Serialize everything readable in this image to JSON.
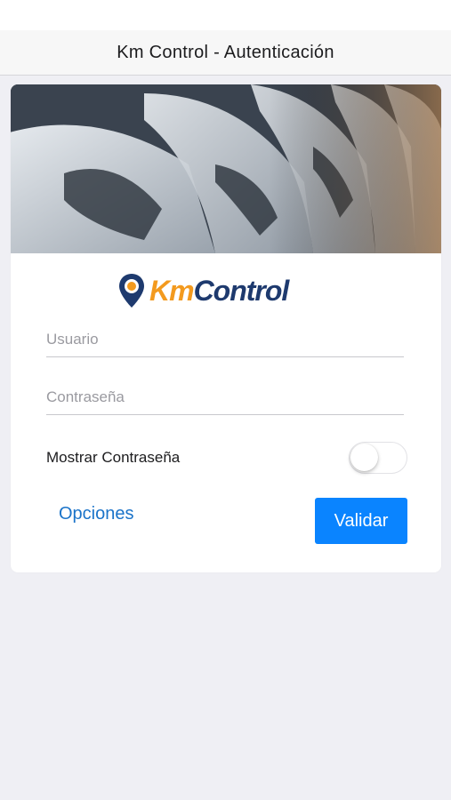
{
  "navbar": {
    "title": "Km Control - Autenticación"
  },
  "logo": {
    "part1": "Km",
    "part2": "Control"
  },
  "form": {
    "username_placeholder": "Usuario",
    "username_value": "",
    "password_placeholder": "Contraseña",
    "password_value": "",
    "show_password_label": "Mostrar Contraseña",
    "show_password_on": false
  },
  "actions": {
    "options_label": "Opciones",
    "validate_label": "Validar"
  },
  "colors": {
    "accent": "#0a84ff",
    "link": "#1a73c9",
    "logo_orange": "#f39a1e",
    "logo_navy": "#1e3a6e"
  }
}
